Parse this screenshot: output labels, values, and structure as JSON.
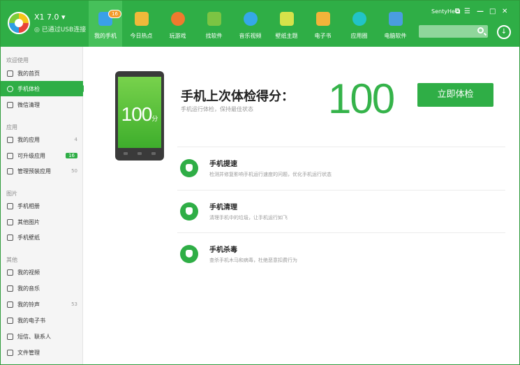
{
  "app": {
    "name": "X1 7.0 ▾",
    "connection": "◎ 已通过USB连接"
  },
  "nav": [
    {
      "label": "我的手机",
      "icon": "phone-icon",
      "badge": "16",
      "active": true,
      "color": "#3aa0e8"
    },
    {
      "label": "今日热点",
      "icon": "star-icon",
      "color": "#f0b93a"
    },
    {
      "label": "玩游戏",
      "icon": "gamepad-icon",
      "color": "#f07a2e"
    },
    {
      "label": "找软件",
      "icon": "android-icon",
      "color": "#7cc443"
    },
    {
      "label": "音乐视频",
      "icon": "play-icon",
      "color": "#35a8e8"
    },
    {
      "label": "壁纸主题",
      "icon": "wallpaper-icon",
      "color": "#d7e24a"
    },
    {
      "label": "电子书",
      "icon": "book-icon",
      "color": "#f2b43a"
    },
    {
      "label": "应用圈",
      "icon": "circle-icon",
      "color": "#22c3c8"
    },
    {
      "label": "电脑软件",
      "icon": "windows-icon",
      "color": "#4a9de0"
    }
  ],
  "window": {
    "user": "SentyHe",
    "controls": [
      "⧉",
      "☰",
      "—",
      "□",
      "✕"
    ]
  },
  "sidebar": {
    "sections": [
      {
        "title": "欢迎使用",
        "items": [
          {
            "label": "我的首页",
            "icon": "home-icon"
          },
          {
            "label": "手机体检",
            "icon": "check-icon",
            "active": true
          },
          {
            "label": "微信清理",
            "icon": "wechat-icon"
          }
        ]
      },
      {
        "title": "应用",
        "items": [
          {
            "label": "我的应用",
            "icon": "apps-icon",
            "count": "4"
          },
          {
            "label": "可升级应用",
            "icon": "upgrade-icon",
            "count": "16",
            "highlight": true
          },
          {
            "label": "管理预装应用",
            "icon": "preinstall-icon",
            "count": "50"
          }
        ]
      },
      {
        "title": "图片",
        "items": [
          {
            "label": "手机相册",
            "icon": "camera-icon"
          },
          {
            "label": "其他图片",
            "icon": "image-icon"
          },
          {
            "label": "手机壁纸",
            "icon": "wallpaper-icon"
          }
        ]
      },
      {
        "title": "其他",
        "items": [
          {
            "label": "我的视频",
            "icon": "video-icon"
          },
          {
            "label": "我的音乐",
            "icon": "music-icon"
          },
          {
            "label": "我的铃声",
            "icon": "bell-icon",
            "count": "53"
          },
          {
            "label": "我的电子书",
            "icon": "ebook-icon"
          },
          {
            "label": "短信、联系人",
            "icon": "contacts-icon"
          },
          {
            "label": "文件管理",
            "icon": "folder-icon"
          }
        ]
      }
    ]
  },
  "main": {
    "phone_score": "100",
    "phone_unit": "分",
    "score_title": "手机上次体检得分：",
    "score_subtitle": "手机运行体检，保持最佳状态",
    "big_score": "100",
    "check_button": "立即体检",
    "features": [
      {
        "title": "手机提速",
        "desc": "检测并修复影响手机运行速度的问题，优化手机运行状态",
        "icon": "rocket-icon"
      },
      {
        "title": "手机清理",
        "desc": "清理手机中的垃圾，让手机运行如飞",
        "icon": "broom-icon"
      },
      {
        "title": "手机杀毒",
        "desc": "查杀手机木马和病毒，杜绝恶意扣费行为",
        "icon": "shield-icon"
      }
    ]
  },
  "colors": {
    "brand": "#2fae46",
    "score": "#35b34a",
    "badge": "#f39a2a"
  }
}
